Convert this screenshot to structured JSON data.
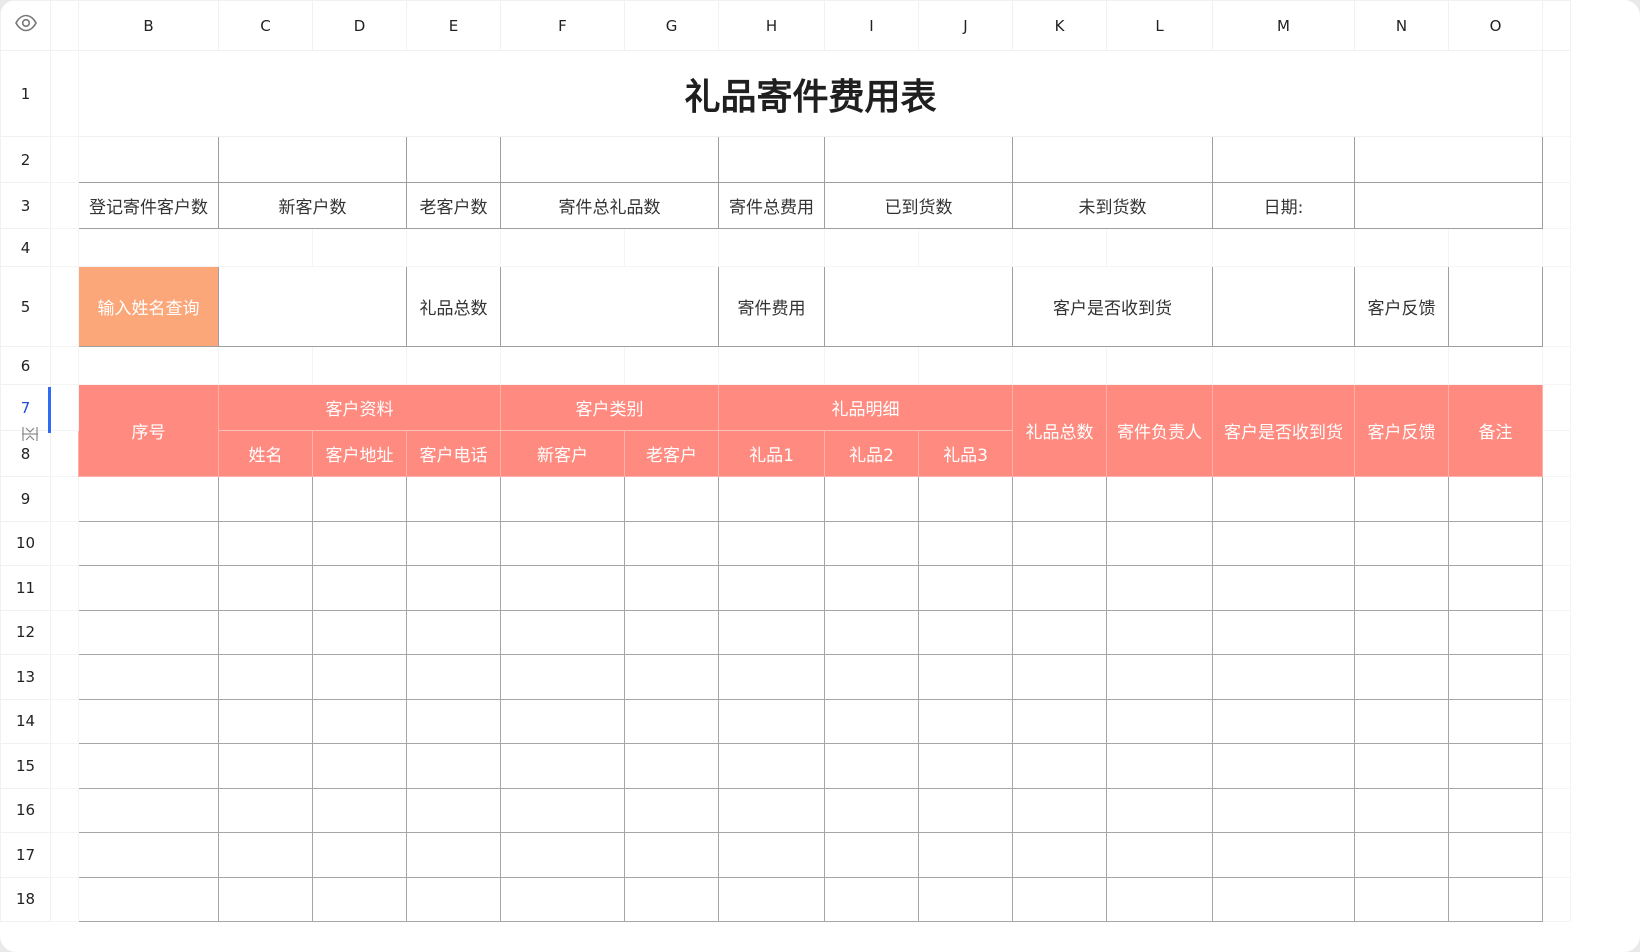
{
  "columns": [
    "B",
    "C",
    "D",
    "E",
    "F",
    "G",
    "H",
    "I",
    "J",
    "K",
    "L",
    "M",
    "N",
    "O"
  ],
  "rows": [
    "1",
    "2",
    "3",
    "4",
    "5",
    "6",
    "7",
    "8",
    "9",
    "10",
    "11",
    "12",
    "13",
    "14",
    "15",
    "16",
    "17",
    "18"
  ],
  "title": "礼品寄件费用表",
  "summary": {
    "registered_customers": "登记寄件客户数",
    "new_customers": "新客户数",
    "old_customers": "老客户数",
    "total_gifts": "寄件总礼品数",
    "total_cost": "寄件总费用",
    "arrived": "已到货数",
    "not_arrived": "未到货数",
    "date_label": "日期:"
  },
  "query": {
    "input_label": "输入姓名查询",
    "gift_total": "礼品总数",
    "shipping_cost": "寄件费用",
    "received": "客户是否收到货",
    "feedback": "客户反馈"
  },
  "header": {
    "seq": "序号",
    "customer_info": "客户资料",
    "customer_type": "客户类别",
    "gift_detail": "礼品明细",
    "gift_total": "礼品总数",
    "handler": "寄件负责人",
    "received": "客户是否收到货",
    "feedback": "客户反馈",
    "notes": "备注",
    "name": "姓名",
    "address": "客户地址",
    "phone": "客户电话",
    "new_customer": "新客户",
    "old_customer": "老客户",
    "gift1": "礼品1",
    "gift2": "礼品2",
    "gift3": "礼品3"
  },
  "colors": {
    "header_fill": "#ff8b80",
    "query_fill": "#fba77a",
    "active_row_indicator": "#2f6cf5"
  }
}
